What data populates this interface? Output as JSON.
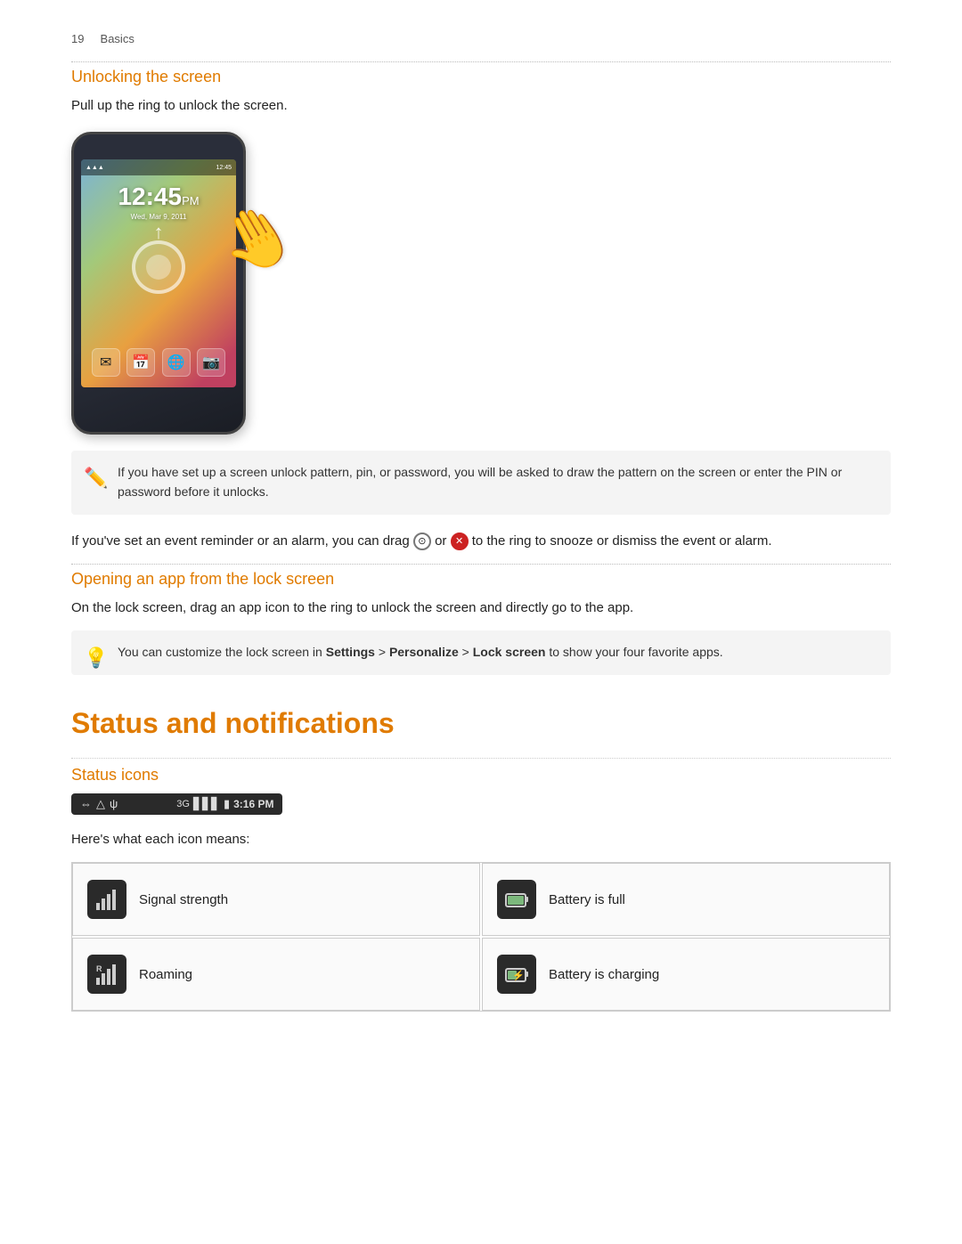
{
  "page": {
    "page_number": "19",
    "page_section": "Basics"
  },
  "unlocking_section": {
    "title": "Unlocking the screen",
    "body": "Pull up the ring to unlock the screen.",
    "phone": {
      "time": "12:45",
      "time_suffix": "PM",
      "date": "Wed, Mar 9, 2011",
      "apps": [
        "✉",
        "📅",
        "🌐",
        "📷"
      ]
    }
  },
  "note_box": {
    "text": "If you have set up a screen unlock pattern, pin, or password, you will be asked to draw the pattern on the screen or enter the PIN or password before it unlocks."
  },
  "drag_text": "If you've set an event reminder or an alarm, you can drag",
  "drag_text2": "or",
  "drag_text3": "to the ring to snooze or dismiss the event or alarm.",
  "lock_screen_section": {
    "title": "Opening an app from the lock screen",
    "body": "On the lock screen, drag an app icon to the ring to unlock the screen and directly go to the app."
  },
  "tip_box": {
    "text_prefix": "You can customize the lock screen in ",
    "settings": "Settings",
    "sep1": " > ",
    "personalize": "Personalize",
    "sep2": " > ",
    "lock_screen": "Lock screen",
    "text_suffix": " to show your four favorite apps."
  },
  "status_section": {
    "title": "Status and notifications"
  },
  "status_icons_section": {
    "title": "Status icons",
    "description": "Here's what each icon means:"
  },
  "status_bar": {
    "left_icons": [
      "⇔",
      "△",
      "ψ"
    ],
    "right_label": "3:16 PM"
  },
  "icons_table": [
    {
      "id": "signal-strength",
      "icon_type": "signal",
      "label": "Signal strength"
    },
    {
      "id": "battery-full",
      "icon_type": "battery-full",
      "label": "Battery is full"
    },
    {
      "id": "roaming",
      "icon_type": "roaming",
      "label": "Roaming"
    },
    {
      "id": "battery-charging",
      "icon_type": "battery-charging",
      "label": "Battery is charging"
    }
  ]
}
